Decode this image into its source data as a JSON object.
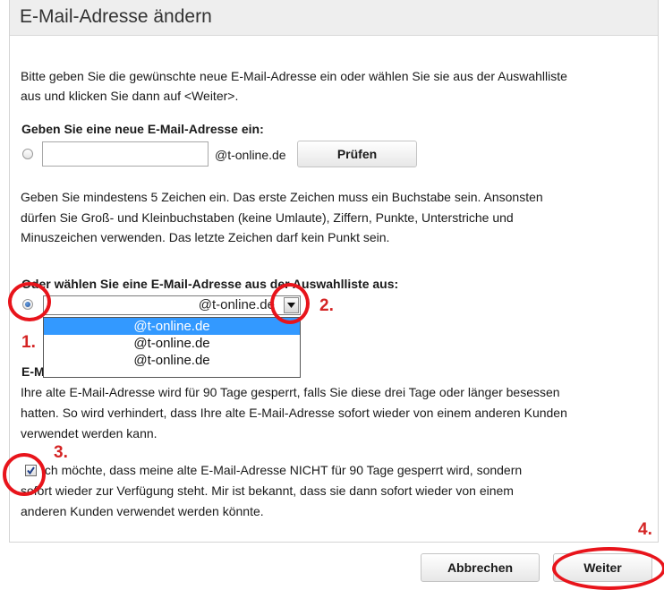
{
  "page": {
    "title": "E-Mail-Adresse ändern"
  },
  "intro": [
    "Bitte geben Sie die gewünschte neue E-Mail-Adresse ein oder wählen Sie sie aus der Auswahlliste",
    "aus und klicken Sie dann auf <Weiter>."
  ],
  "new_address": {
    "heading": "Geben Sie eine neue E-Mail-Adresse ein:",
    "input_value": "",
    "domain_suffix": "@t-online.de",
    "check_button": "Prüfen",
    "hint": [
      "Geben Sie mindestens 5 Zeichen ein. Das erste Zeichen muss ein Buchstabe sein. Ansonsten",
      "dürfen Sie Groß- und Kleinbuchstaben (keine Umlaute), Ziffern, Punkte, Unterstriche und",
      "Minuszeichen verwenden. Das letzte Zeichen darf kein Punkt sein."
    ]
  },
  "select_list": {
    "heading": "Oder wählen Sie eine E-Mail-Adresse aus der Auswahlliste aus:",
    "selected_value": "@t-online.de",
    "options": [
      "@t-online.de",
      "@t-online.de",
      "@t-online.de"
    ]
  },
  "old_address": {
    "heading_partial": "E-M",
    "text": [
      "Ihre alte E-Mail-Adresse wird für 90 Tage gesperrt, falls Sie diese drei Tage oder länger besessen",
      "hatten. So wird verhindert, dass Ihre alte E-Mail-Adresse sofort wieder von einem anderen Kunden",
      "verwendet werden kann."
    ],
    "checkbox_checked": true,
    "checkbox_label": [
      "Ich möchte, dass meine alte E-Mail-Adresse NICHT für 90 Tage gesperrt wird, sondern",
      "sofort wieder zur Verfügung steht. Mir ist bekannt, dass sie dann sofort wieder von einem",
      "anderen Kunden verwendet werden könnte."
    ]
  },
  "actions": {
    "cancel": "Abbrechen",
    "next": "Weiter"
  },
  "annotations": {
    "step1": "1.",
    "step2": "2.",
    "step3": "3.",
    "step4": "4.",
    "color": "#e8141b"
  },
  "icons": {
    "dropdown": "chevron-down-icon",
    "checkbox": "checkmark-icon"
  }
}
